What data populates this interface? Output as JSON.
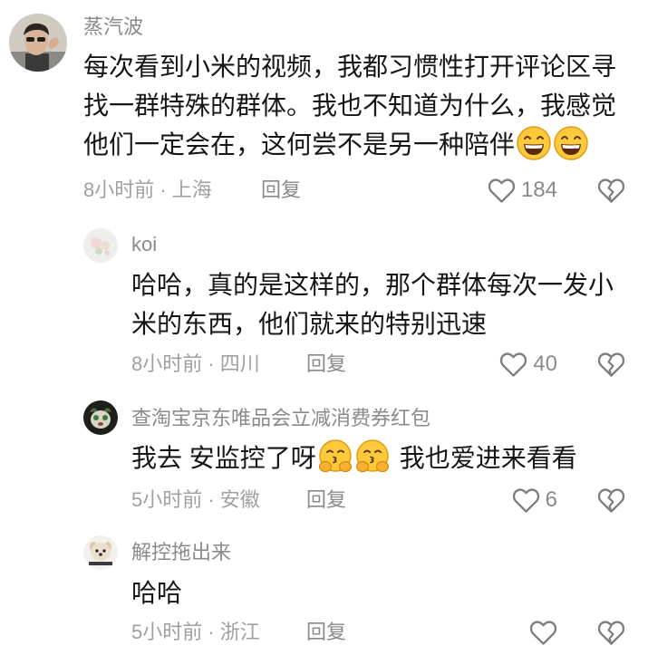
{
  "comments": [
    {
      "username": "蒸汽波",
      "text": "每次看到小米的视频，我都习惯性打开评论区寻找一群特殊的群体。我也不知道为什么，我感觉他们一定会在，这何尝不是另一种陪伴",
      "emojis": [
        "grinning-face",
        "grinning-face"
      ],
      "meta": "8小时前 · 上海",
      "reply_label": "回复",
      "likes": "184"
    },
    {
      "username": "koi",
      "text": "哈哈，真的是这样的，那个群体每次一发小米的东西，他们就来的特别迅速",
      "meta": "8小时前 · 四川",
      "reply_label": "回复",
      "likes": "40"
    },
    {
      "username": "查淘宝京东唯品会立减消费券红包",
      "text": "我去 安监控了呀",
      "emojis": [
        "hugging-face",
        "hugging-face"
      ],
      "text_after": "我也爱进来看看",
      "meta": "5小时前 · 安徽",
      "reply_label": "回复",
      "likes": "6"
    },
    {
      "username": "解控拖出来",
      "text": "哈哈",
      "meta": "5小时前 · 浙江",
      "reply_label": "回复"
    }
  ],
  "icons": {
    "like": "heart-outline-icon",
    "dislike": "broken-heart-icon"
  },
  "colors": {
    "background": "#ffffff",
    "text": "#161616",
    "secondary": "#8a8a8a",
    "meta": "#a0a0a0",
    "icon": "#7d7d7d",
    "emoji_yellow": "#FFC93C"
  }
}
